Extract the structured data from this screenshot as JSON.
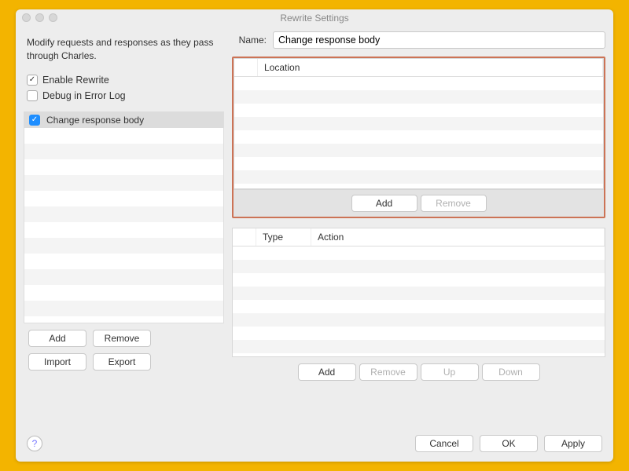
{
  "window": {
    "title": "Rewrite Settings"
  },
  "left": {
    "description": "Modify requests and responses as they pass through Charles.",
    "enable_rewrite_label": "Enable Rewrite",
    "enable_rewrite_checked": true,
    "debug_label": "Debug in Error Log",
    "debug_checked": false,
    "rules": [
      {
        "checked": true,
        "name": "Change response body"
      }
    ],
    "buttons": {
      "add": "Add",
      "remove": "Remove",
      "import": "Import",
      "export": "Export"
    }
  },
  "right": {
    "name_label": "Name:",
    "name_value": "Change response body",
    "location": {
      "header": "Location",
      "add": "Add",
      "remove": "Remove"
    },
    "actions": {
      "type_header": "Type",
      "action_header": "Action",
      "add": "Add",
      "remove": "Remove",
      "up": "Up",
      "down": "Down"
    }
  },
  "footer": {
    "help": "?",
    "cancel": "Cancel",
    "ok": "OK",
    "apply": "Apply"
  }
}
